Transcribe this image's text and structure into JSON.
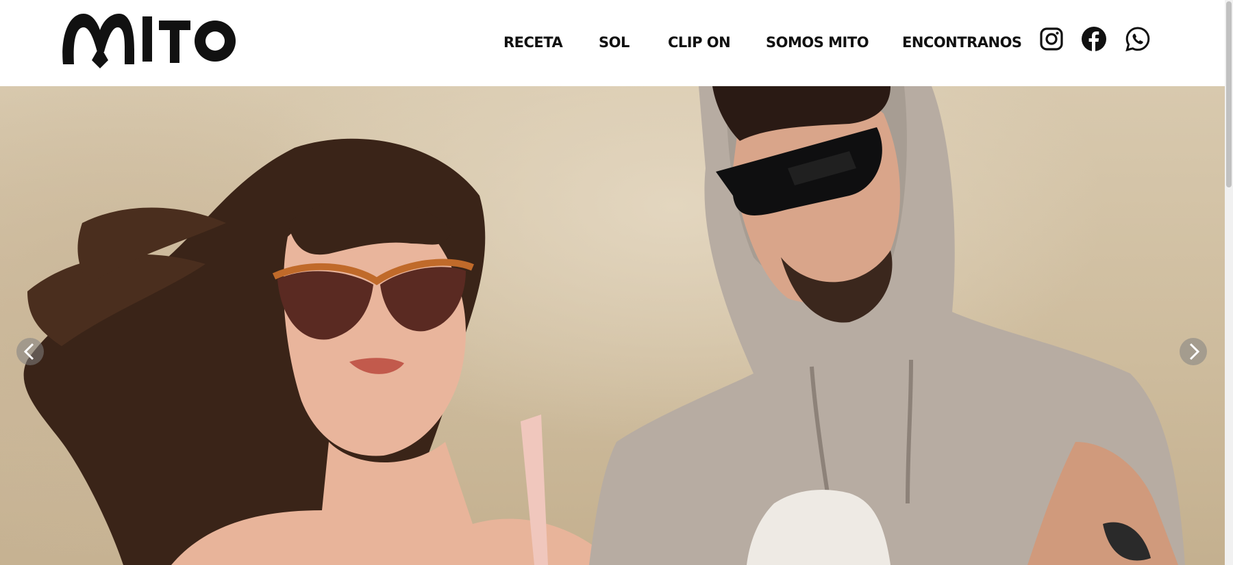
{
  "brand": {
    "logo_text": "MITO",
    "logo_color": "#111111"
  },
  "nav": {
    "items": [
      {
        "label": "RECETA"
      },
      {
        "label": "SOL"
      },
      {
        "label": "CLIP ON"
      },
      {
        "label": "SOMOS MITO"
      },
      {
        "label": "ENCONTRANOS"
      }
    ]
  },
  "social": {
    "instagram": "instagram-icon",
    "facebook": "facebook-icon",
    "whatsapp": "whatsapp-icon"
  },
  "hero": {
    "slider_controls": {
      "prev": "chevron-left-icon",
      "next": "chevron-right-icon"
    }
  }
}
